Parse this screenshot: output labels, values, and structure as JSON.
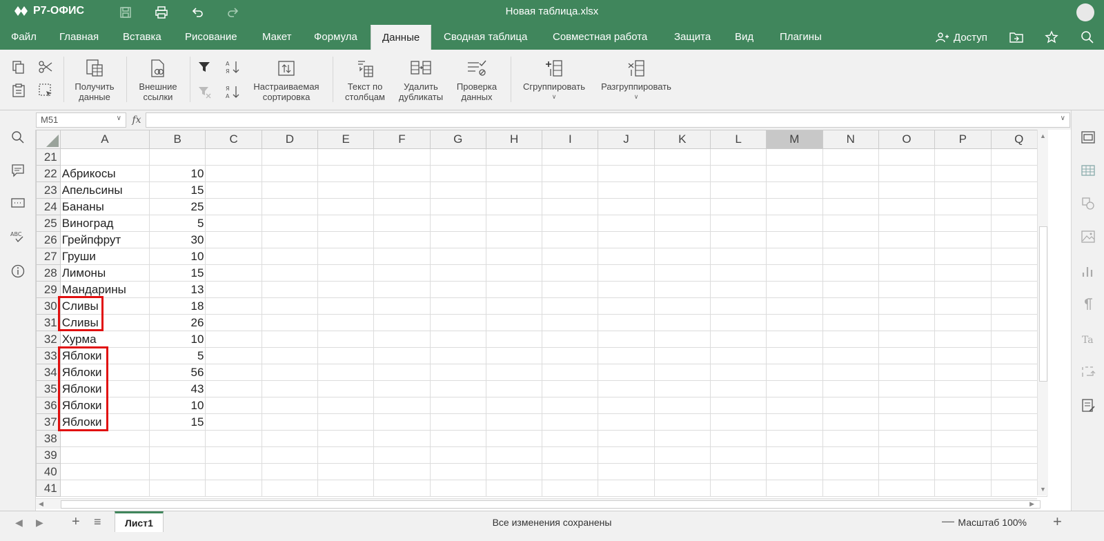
{
  "app": {
    "brand": "Р7-ОФИС",
    "title": "Новая таблица.xlsx"
  },
  "menu": {
    "tabs": [
      "Файл",
      "Главная",
      "Вставка",
      "Рисование",
      "Макет",
      "Формула",
      "Данные",
      "Сводная таблица",
      "Совместная работа",
      "Защита",
      "Вид",
      "Плагины"
    ],
    "active_tab": "Данные",
    "access_label": "Доступ"
  },
  "toolbar": {
    "get_data": "Получить данные",
    "external_links": "Внешние ссылки",
    "custom_sort": "Настраиваемая сортировка",
    "text_to_columns": "Текст по столбцам",
    "remove_duplicates": "Удалить дубликаты",
    "data_validation": "Проверка данных",
    "group": "Сгруппировать",
    "ungroup": "Разгруппировать"
  },
  "formula_bar": {
    "cell_ref": "M51",
    "fx": "fx",
    "value": ""
  },
  "grid": {
    "columns": [
      "A",
      "B",
      "C",
      "D",
      "E",
      "F",
      "G",
      "H",
      "I",
      "J",
      "K",
      "L",
      "M",
      "N",
      "O",
      "P",
      "Q"
    ],
    "selected_column": "M",
    "rows": [
      {
        "n": "21",
        "a": "",
        "b": ""
      },
      {
        "n": "22",
        "a": "Абрикосы",
        "b": "10"
      },
      {
        "n": "23",
        "a": "Апельсины",
        "b": "15"
      },
      {
        "n": "24",
        "a": "Бананы",
        "b": "25"
      },
      {
        "n": "25",
        "a": "Виноград",
        "b": "5"
      },
      {
        "n": "26",
        "a": "Грейпфрут",
        "b": "30"
      },
      {
        "n": "27",
        "a": "Груши",
        "b": "10"
      },
      {
        "n": "28",
        "a": "Лимоны",
        "b": "15"
      },
      {
        "n": "29",
        "a": "Мандарины",
        "b": "13"
      },
      {
        "n": "30",
        "a": "Сливы",
        "b": "18"
      },
      {
        "n": "31",
        "a": "Сливы",
        "b": "26"
      },
      {
        "n": "32",
        "a": "Хурма",
        "b": "10"
      },
      {
        "n": "33",
        "a": "Яблоки",
        "b": "5"
      },
      {
        "n": "34",
        "a": "Яблоки",
        "b": "56"
      },
      {
        "n": "35",
        "a": "Яблоки",
        "b": "43"
      },
      {
        "n": "36",
        "a": "Яблоки",
        "b": "10"
      },
      {
        "n": "37",
        "a": "Яблоки",
        "b": "15"
      },
      {
        "n": "38",
        "a": "",
        "b": ""
      },
      {
        "n": "39",
        "a": "",
        "b": ""
      },
      {
        "n": "40",
        "a": "",
        "b": ""
      },
      {
        "n": "41",
        "a": "",
        "b": ""
      }
    ]
  },
  "status": {
    "sheet_name": "Лист1",
    "message": "Все изменения сохранены",
    "zoom": "Масштаб 100%"
  },
  "colors": {
    "brand": "#40865c",
    "highlight": "#e10f0f"
  }
}
